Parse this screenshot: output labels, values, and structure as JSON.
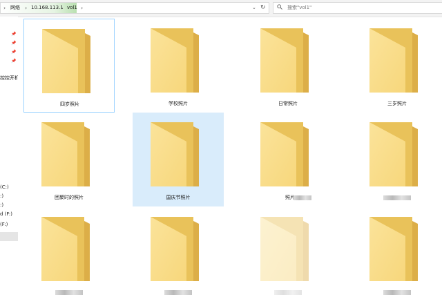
{
  "address_bar": {
    "crumbs": [
      "网络",
      "10.168.113.1",
      "vol1"
    ],
    "dropdown_glyph": "⌄",
    "refresh_glyph": "↻"
  },
  "search": {
    "placeholder": "搜索\"vol1\""
  },
  "nav_pane": {
    "pins": [
      "📌",
      "📌",
      "📌",
      "📌"
    ],
    "items": [
      "控控开机",
      "(C:)",
      ":)",
      ":)",
      "d (F:)",
      "(F:)"
    ]
  },
  "folders": [
    {
      "label": "四岁照片",
      "state": "focused"
    },
    {
      "label": "学校照片",
      "state": "normal"
    },
    {
      "label": "日常照片",
      "state": "normal"
    },
    {
      "label": "三岁照片",
      "state": "normal"
    },
    {
      "label": "团聚时的照片",
      "state": "normal"
    },
    {
      "label": "国庆节照片",
      "state": "selected"
    },
    {
      "label": "照片",
      "state": "normal",
      "obscured": "partial"
    },
    {
      "label": "",
      "state": "normal",
      "obscured": "full"
    },
    {
      "label": "",
      "state": "normal",
      "obscured": "full"
    },
    {
      "label": "",
      "state": "normal",
      "obscured": "full"
    },
    {
      "label": "",
      "state": "ghosted",
      "obscured": "full"
    },
    {
      "label": "",
      "state": "normal",
      "obscured": "full"
    }
  ],
  "colors": {
    "folder_back": "#e9c25a",
    "folder_front": "#f7d77c",
    "selection": "#d9ecfb",
    "focus_border": "#99d1ff",
    "address_accent": "#b9e0b0"
  }
}
